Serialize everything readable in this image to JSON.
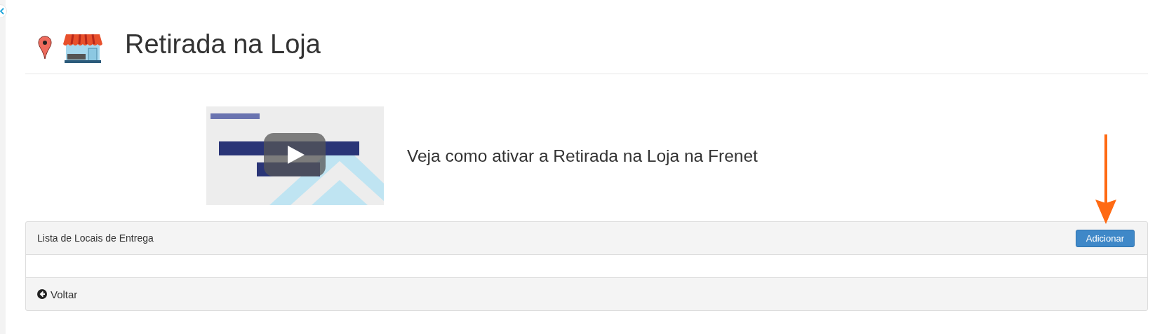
{
  "title": "Retirada na Loja",
  "video": {
    "kind": "picture",
    "caption": "Veja como ativar a Retirada na Loja na Frenet"
  },
  "panel": {
    "heading": "Lista de Locais de Entrega",
    "add_button": "Adicionar",
    "back_link": "Voltar"
  }
}
